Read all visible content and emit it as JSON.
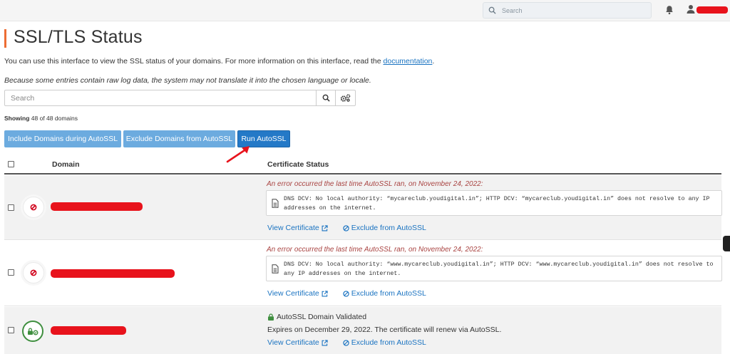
{
  "topbar": {
    "search_placeholder": "Search"
  },
  "page": {
    "title": "SSL/TLS Status",
    "description_prefix": "You can use this interface to view the SSL status of your domains. For more information on this interface, read the ",
    "description_link": "documentation",
    "description_suffix": ".",
    "note": "Because some entries contain raw log data, the system may not translate it into the chosen language or locale."
  },
  "search": {
    "placeholder": "Search"
  },
  "showing": {
    "label": "Showing",
    "text": " 48 of 48 domains"
  },
  "actions": {
    "include_label": "Include Domains during AutoSSL",
    "exclude_label": "Exclude Domains from AutoSSL",
    "run_label": "Run AutoSSL"
  },
  "table": {
    "headers": {
      "domain": "Domain",
      "status": "Certificate Status"
    },
    "rows": [
      {
        "status_type": "error",
        "error_message": "An error occurred the last time AutoSSL ran, on November 24, 2022:",
        "log": "DNS DCV: No local authority: “mycareclub.youdigital.in”; HTTP DCV: “mycareclub.youdigital.in” does not resolve to any IP addresses on the internet.",
        "view_label": "View Certificate",
        "exclude_label": "Exclude from AutoSSL"
      },
      {
        "status_type": "error",
        "error_message": "An error occurred the last time AutoSSL ran, on November 24, 2022:",
        "log": "DNS DCV: No local authority: “www.mycareclub.youdigital.in”; HTTP DCV: “www.mycareclub.youdigital.in” does not resolve to any IP addresses on the internet.",
        "view_label": "View Certificate",
        "exclude_label": "Exclude from AutoSSL"
      },
      {
        "status_type": "validated",
        "validated_message": "AutoSSL Domain Validated",
        "expires": "Expires on December 29, 2022. The certificate will renew via AutoSSL.",
        "view_label": "View Certificate",
        "exclude_label": "Exclude from AutoSSL"
      }
    ]
  },
  "colors": {
    "accent": "#ed6d34",
    "primary_button": "#2479c7",
    "light_button": "#6cabdf",
    "link": "#1a73c1",
    "error_text": "#a94442",
    "success": "#3f8f3f",
    "redaction": "#e8131c"
  }
}
